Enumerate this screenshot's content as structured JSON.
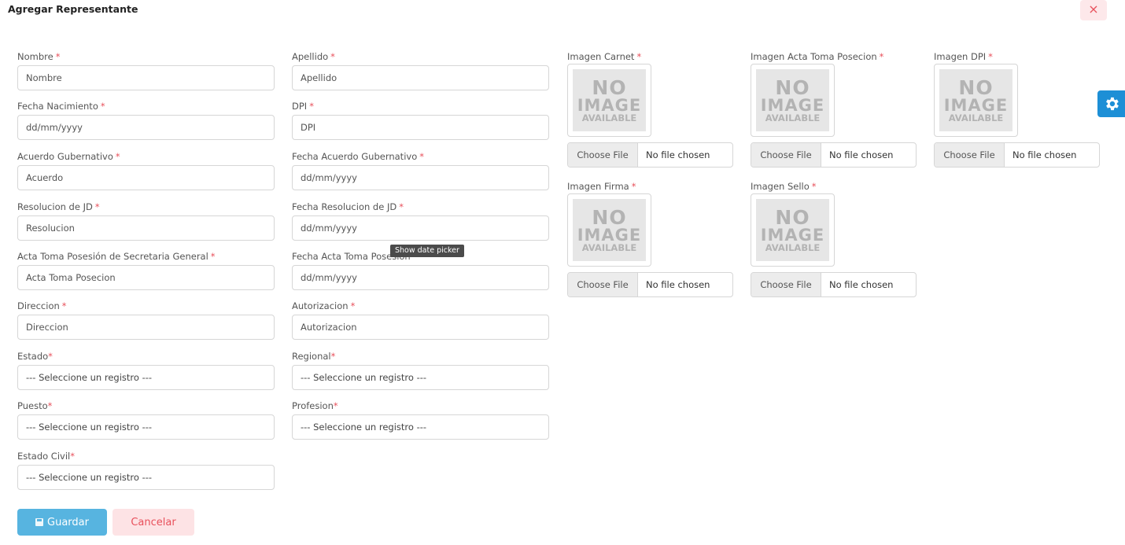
{
  "modal": {
    "title": "Agregar Representante",
    "close_icon": "×",
    "settings_icon": "gear-icon"
  },
  "required_mark": "*",
  "tooltip": "Show date picker",
  "fields": {
    "nombre": {
      "label": "Nombre",
      "placeholder": "Nombre"
    },
    "apellido": {
      "label": "Apellido",
      "placeholder": "Apellido"
    },
    "fecha_nacimiento": {
      "label": "Fecha Nacimiento",
      "placeholder": "dd/mm/yyyy"
    },
    "dpi": {
      "label": "DPI",
      "placeholder": "DPI"
    },
    "acuerdo_gubernativo": {
      "label": "Acuerdo Gubernativo",
      "placeholder": "Acuerdo"
    },
    "fecha_acuerdo_gubernativo": {
      "label": "Fecha Acuerdo Gubernativo",
      "placeholder": "dd/mm/yyyy"
    },
    "resolucion_jd": {
      "label": "Resolucion de JD",
      "placeholder": "Resolucion"
    },
    "fecha_resolucion_jd": {
      "label": "Fecha Resolucion de JD",
      "placeholder": "dd/mm/yyyy"
    },
    "acta_toma_posesion": {
      "label": "Acta Toma Posesión de Secretaria General",
      "placeholder": "Acta Toma Posecion"
    },
    "fecha_acta_toma_posesion": {
      "label": "Fecha Acta Toma Posesion",
      "placeholder": "dd/mm/yyyy"
    },
    "direccion": {
      "label": "Direccion",
      "placeholder": "Direccion"
    },
    "autorizacion": {
      "label": "Autorizacion",
      "placeholder": "Autorizacion"
    },
    "estado": {
      "label": "Estado",
      "selected": "--- Seleccione un registro ---"
    },
    "regional": {
      "label": "Regional",
      "selected": "--- Seleccione un registro ---"
    },
    "puesto": {
      "label": "Puesto",
      "selected": "--- Seleccione un registro ---"
    },
    "profesion": {
      "label": "Profesion",
      "selected": "--- Seleccione un registro ---"
    },
    "estado_civil": {
      "label": "Estado Civil",
      "selected": "--- Seleccione un registro ---"
    }
  },
  "no_image": {
    "line1": "NO",
    "line2": "IMAGE",
    "line3": "AVAILABLE"
  },
  "images": {
    "carnet": {
      "label": "Imagen Carnet",
      "choose": "Choose File",
      "status": "No file chosen"
    },
    "acta": {
      "label": "Imagen Acta Toma Posecion",
      "choose": "Choose File",
      "status": "No file chosen"
    },
    "dpi": {
      "label": "Imagen DPI",
      "choose": "Choose File",
      "status": "No file chosen"
    },
    "firma": {
      "label": "Imagen Firma",
      "choose": "Choose File",
      "status": "No file chosen"
    },
    "sello": {
      "label": "Imagen Sello",
      "choose": "Choose File",
      "status": "No file chosen"
    }
  },
  "buttons": {
    "save": "Guardar",
    "cancel": "Cancelar"
  },
  "colors": {
    "primary": "#57b4e0",
    "danger": "#e8505b",
    "settings": "#1d8fd6"
  }
}
